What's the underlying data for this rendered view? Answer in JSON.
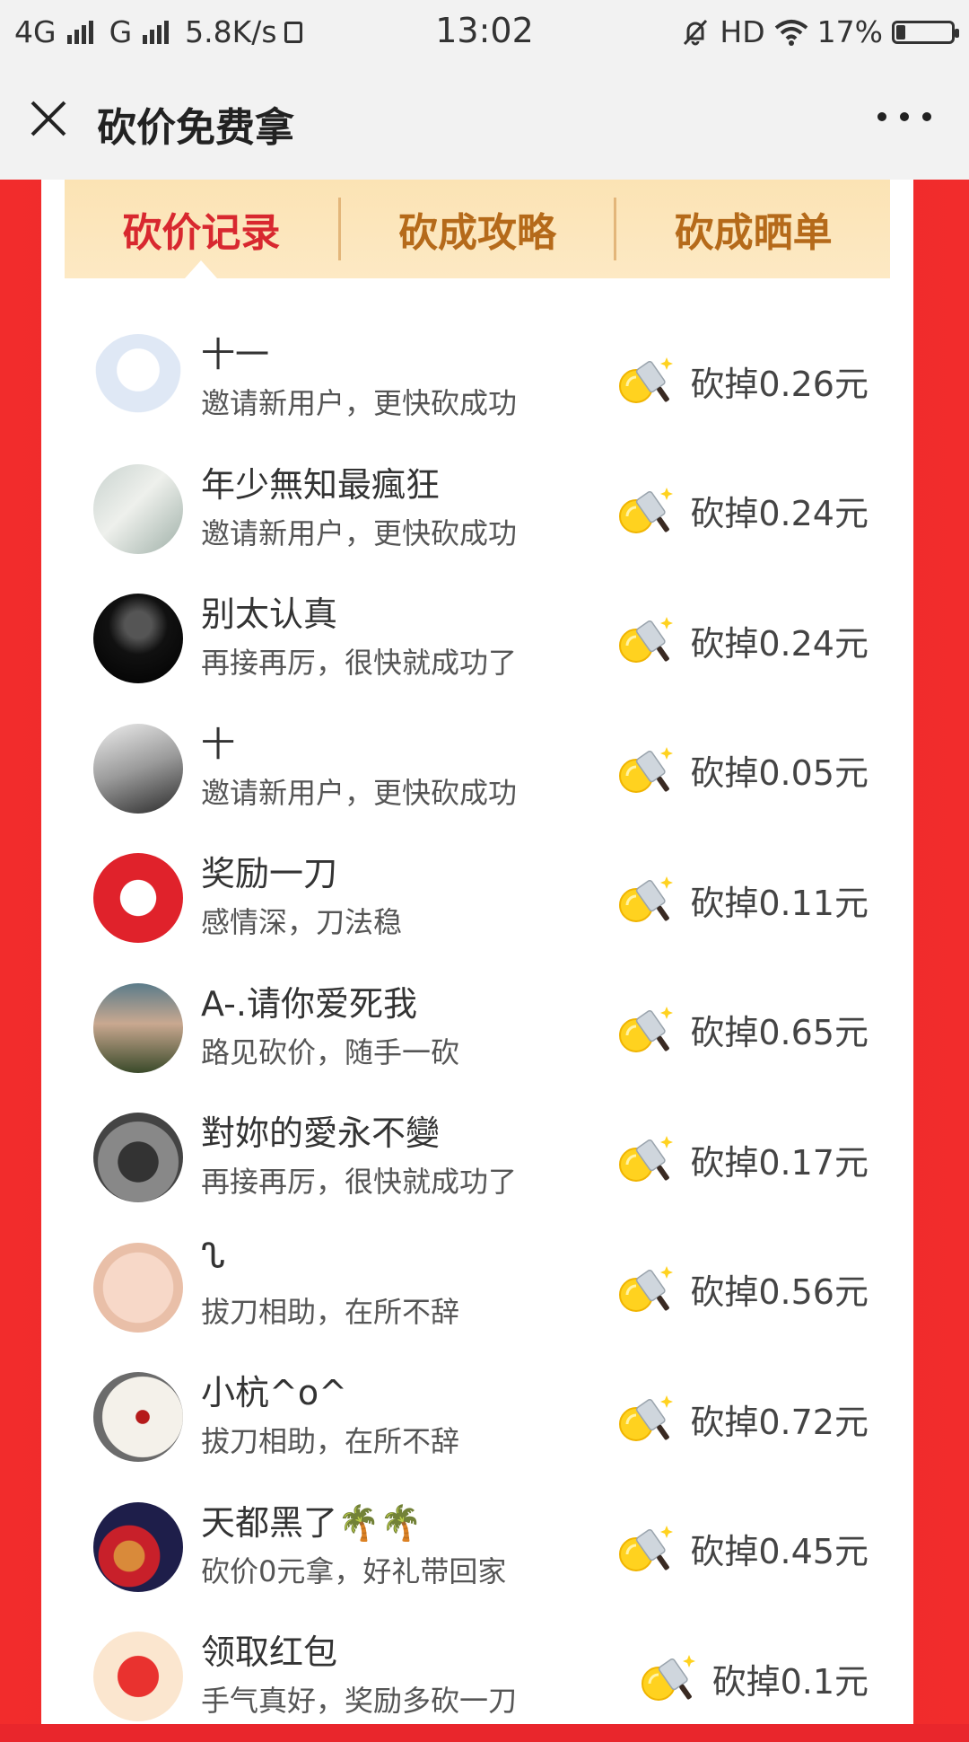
{
  "status_bar": {
    "network_left": "4G",
    "network_mid": "G",
    "speed": "5.8K/s",
    "time": "13:02",
    "hd": "HD",
    "battery": "17%"
  },
  "title_bar": {
    "title": "砍价免费拿"
  },
  "tabs": [
    {
      "label": "砍价记录",
      "active": true
    },
    {
      "label": "砍成攻略",
      "active": false
    },
    {
      "label": "砍成晒单",
      "active": false
    }
  ],
  "records": [
    {
      "name": "十一",
      "message": "邀请新用户，更快砍成功",
      "amount": "砍掉0.26元",
      "avatar": "cartoon-boy"
    },
    {
      "name": "年少無知最瘋狂",
      "message": "邀请新用户，更快砍成功",
      "amount": "砍掉0.24元",
      "avatar": "girl-photo"
    },
    {
      "name": "别太认真",
      "message": "再接再厉，很快就成功了",
      "amount": "砍掉0.24元",
      "avatar": "dark-photo"
    },
    {
      "name": "十",
      "message": "邀请新用户，更快砍成功",
      "amount": "砍掉0.05元",
      "avatar": "anime-boy"
    },
    {
      "name": "奖励一刀",
      "message": "感情深，刀法稳",
      "amount": "砍掉0.11元",
      "avatar": "pinduoduo-logo"
    },
    {
      "name": "A-.请你爱死我",
      "message": "路见砍价，随手一砍",
      "amount": "砍掉0.65元",
      "avatar": "girl-portrait"
    },
    {
      "name": "對妳的愛永不變",
      "message": "再接再厉，很快就成功了",
      "amount": "砍掉0.17元",
      "avatar": "cartoon-sunglasses"
    },
    {
      "name": "ᔐ",
      "message": "拔刀相助，在所不辞",
      "amount": "砍掉0.56元",
      "avatar": "baby-face"
    },
    {
      "name": "小杭^o^",
      "message": "拔刀相助，在所不辞",
      "amount": "砍掉0.72元",
      "avatar": "ink-painting"
    },
    {
      "name": "天都黑了🌴🌴",
      "message": "砍价0元拿，好礼带回家",
      "amount": "砍掉0.45元",
      "avatar": "toys-photo"
    },
    {
      "name": "领取红包",
      "message": "手气真好，奖励多砍一刀",
      "amount": "砍掉0.1元",
      "avatar": "red-envelope"
    }
  ]
}
